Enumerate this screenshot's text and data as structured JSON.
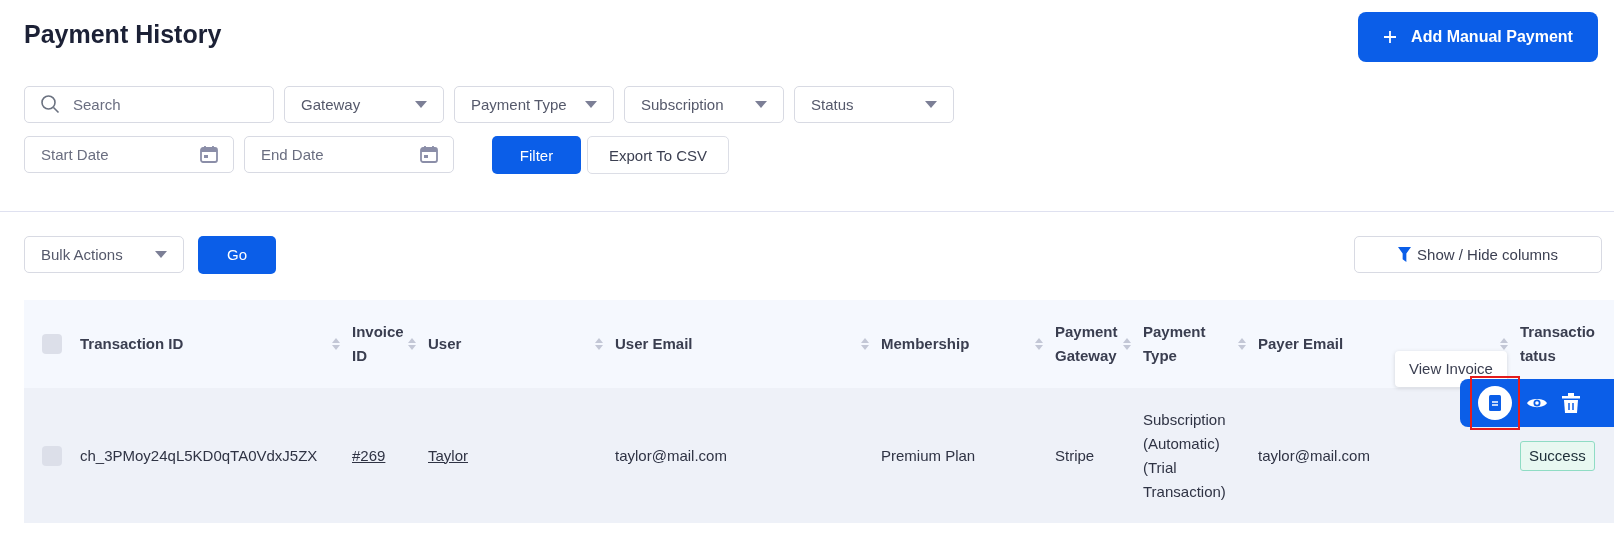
{
  "page": {
    "title": "Payment History",
    "add_button": "Add Manual Payment"
  },
  "filters": {
    "search": {
      "placeholder": "Search"
    },
    "dropdowns": [
      {
        "placeholder": "Gateway"
      },
      {
        "placeholder": "Payment Type"
      },
      {
        "placeholder": "Subscription"
      },
      {
        "placeholder": "Status"
      }
    ],
    "dates": [
      {
        "placeholder": "Start Date"
      },
      {
        "placeholder": "End Date"
      }
    ],
    "buttons": [
      {
        "label": "Filter",
        "kind": "primary"
      },
      {
        "label": "Export To CSV",
        "kind": "secondary"
      }
    ]
  },
  "bulk": {
    "dropdown": "Bulk Actions",
    "go": "Go",
    "columns_button": "Show / Hide columns"
  },
  "table": {
    "select_all": {
      "checked": false
    },
    "columns": [
      {
        "lines": [
          "Transaction ID"
        ],
        "sortable": true
      },
      {
        "lines": [
          "Invoice",
          "ID"
        ],
        "sortable": true
      },
      {
        "lines": [
          "User"
        ],
        "sortable": true
      },
      {
        "lines": [
          "User Email"
        ],
        "sortable": true
      },
      {
        "lines": [
          "Membership"
        ],
        "sortable": true
      },
      {
        "lines": [
          "Payment",
          "Gateway"
        ],
        "sortable": true
      },
      {
        "lines": [
          "Payment",
          "Type"
        ],
        "sortable": true
      },
      {
        "lines": [
          "Payer Email"
        ],
        "sortable": true
      },
      {
        "lines": [
          "Transactio",
          "tatus"
        ],
        "sortable": false
      }
    ],
    "rows": [
      {
        "checked": false,
        "cells": [
          {
            "text": "ch_3PMoy24qL5KD0qTA0VdxJ5ZX",
            "kind": "text"
          },
          {
            "text": "#269",
            "kind": "link"
          },
          {
            "text": "Taylor",
            "kind": "link"
          },
          {
            "text": "taylor@mail.com",
            "kind": "text"
          },
          {
            "text": "Premium Plan",
            "kind": "text"
          },
          {
            "text": "Stripe",
            "kind": "text"
          },
          {
            "text": "Subscription (Automatic) (Trial Transaction)",
            "kind": "text"
          },
          {
            "text": "taylor@mail.com",
            "kind": "text"
          },
          {
            "text": "Success",
            "kind": "badge"
          }
        ],
        "actions": {
          "tooltip": "View Invoice",
          "highlighted": true
        }
      }
    ]
  }
}
